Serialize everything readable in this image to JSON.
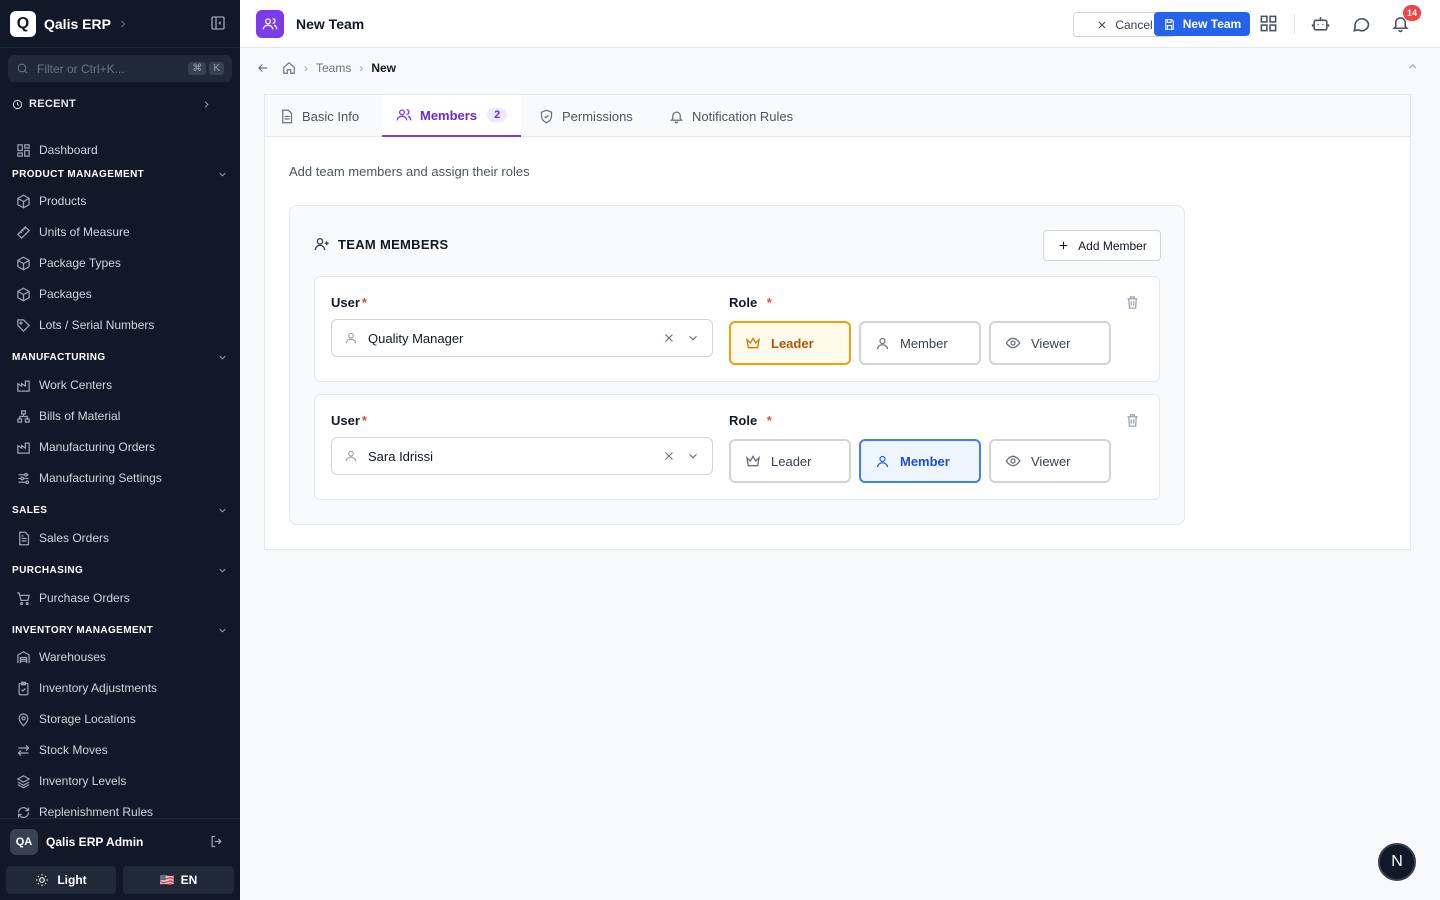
{
  "sidebar": {
    "app_name": "Qalis ERP",
    "logo_letter": "Q",
    "filter_placeholder": "Filter or Ctrl+K...",
    "filter_kbd": [
      "⌘",
      "K"
    ],
    "recent_label": "RECENT",
    "dashboard": "Dashboard",
    "sections": {
      "product": "PRODUCT MANAGEMENT",
      "manufacturing": "MANUFACTURING",
      "sales": "SALES",
      "purchasing": "PURCHASING",
      "inventory": "INVENTORY MANAGEMENT"
    },
    "items": {
      "products": "Products",
      "uom": "Units of Measure",
      "package_types": "Package Types",
      "packages": "Packages",
      "lots": "Lots / Serial Numbers",
      "work_centers": "Work Centers",
      "bom": "Bills of Material",
      "mfg_orders": "Manufacturing Orders",
      "mfg_settings": "Manufacturing Settings",
      "sales_orders": "Sales Orders",
      "purchase_orders": "Purchase Orders",
      "warehouses": "Warehouses",
      "inv_adjust": "Inventory Adjustments",
      "storage": "Storage Locations",
      "stock_moves": "Stock Moves",
      "inv_levels": "Inventory Levels",
      "replenish": "Replenishment Rules"
    },
    "footer": {
      "avatar": "QA",
      "user_name": "Qalis ERP Admin",
      "theme": "Light",
      "flag": "🇺🇸",
      "lang": "EN"
    }
  },
  "header": {
    "title": "New Team",
    "cancel": "Cancel",
    "new_team": "New Team",
    "notification_count": "14"
  },
  "breadcrumb": {
    "teams": "Teams",
    "current": "New"
  },
  "tabs": {
    "basic": "Basic Info",
    "members": "Members",
    "members_count": "2",
    "permissions": "Permissions",
    "notifications": "Notification Rules"
  },
  "main": {
    "description": "Add team members and assign their roles",
    "section_title": "TEAM MEMBERS",
    "add_member": "Add Member",
    "user_label": "User",
    "role_label": "Role",
    "required": "*",
    "roles": {
      "leader": "Leader",
      "member": "Member",
      "viewer": "Viewer"
    },
    "members": [
      {
        "user": "Quality Manager",
        "role": "Leader"
      },
      {
        "user": "Sara Idrissi",
        "role": "Member"
      }
    ]
  },
  "fab_letter": "N",
  "colors": {
    "sidebar_bg": "#111827",
    "accent_purple": "#7c3aed",
    "primary_blue": "#2563eb",
    "leader_amber": "#f59e0b",
    "badge_red": "#ef4444"
  }
}
